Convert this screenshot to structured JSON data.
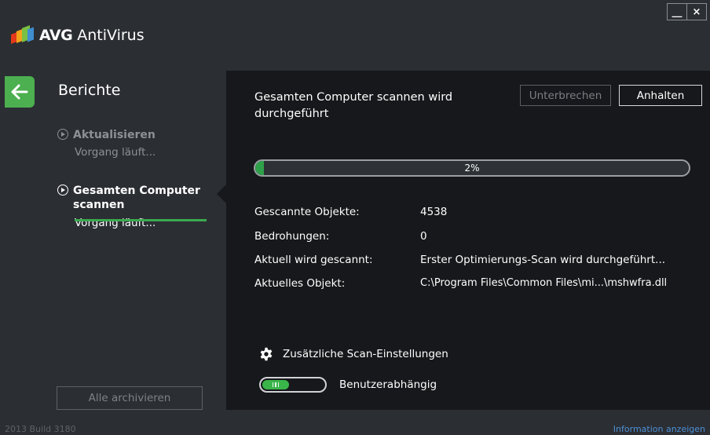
{
  "app": {
    "brand": "AVG",
    "product": "AntiVirus",
    "window_controls": {
      "minimize": "__",
      "close": "×"
    }
  },
  "sidebar": {
    "title": "Berichte",
    "items": [
      {
        "label": "Aktualisieren",
        "status": "Vorgang läuft..."
      },
      {
        "label": "Gesamten Computer scannen",
        "status": "Vorgang läuft..."
      }
    ],
    "archive_all": "Alle archivieren"
  },
  "scan": {
    "title": "Gesamten Computer scannen wird durchgeführt",
    "pause_label": "Unterbrechen",
    "stop_label": "Anhalten",
    "progress_percent": 2,
    "progress_label": "2%",
    "details": [
      {
        "label": "Gescannte Objekte:",
        "value": "4538"
      },
      {
        "label": "Bedrohungen:",
        "value": "0"
      },
      {
        "label": "Aktuell wird gescannt:",
        "value": "Erster Optimierungs-Scan wird durchgeführt..."
      },
      {
        "label": "Aktuelles Objekt:",
        "value": "C:\\Program Files\\Common Files\\mi...\\mshwfra.dll"
      }
    ],
    "extra_settings": "Zusätzliche Scan-Einstellungen",
    "priority_label": "Benutzerabhängig"
  },
  "footer": {
    "build": "2013  Build 3180",
    "info_link": "Information anzeigen"
  },
  "colors": {
    "accent_green": "#2fa04a",
    "back_button": "#4caf50",
    "panel_bg": "#16181b",
    "window_bg": "#2b2e33",
    "link_blue": "#4d90d6"
  },
  "icons": [
    "back-arrow-icon",
    "minimize-icon",
    "close-icon",
    "play-circle-icon",
    "gear-icon",
    "toggle-switch"
  ]
}
